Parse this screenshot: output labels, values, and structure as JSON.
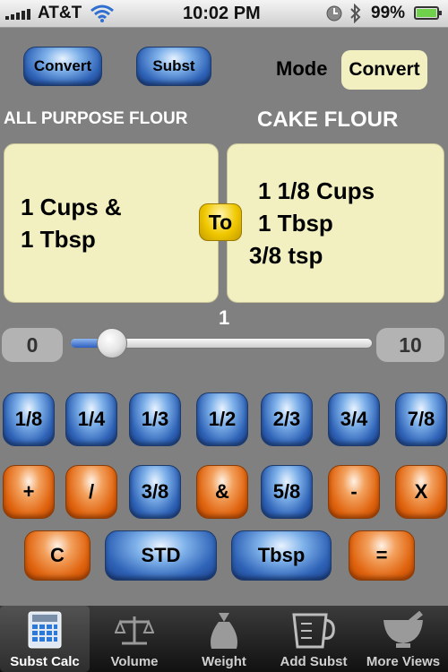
{
  "status": {
    "carrier": "AT&T",
    "time": "10:02 PM",
    "battery": "99%"
  },
  "top": {
    "convert_label": "Convert",
    "subst_label": "Subst",
    "mode_label": "Mode",
    "mode_value": "Convert"
  },
  "from": {
    "title": "ALL PURPOSE FLOUR",
    "line1": "1  Cups &",
    "line2": "1  Tbsp"
  },
  "to": {
    "title": "CAKE FLOUR",
    "line1": "1 1/8 Cups",
    "line2": "1  Tbsp",
    "line3": "3/8 tsp"
  },
  "to_button": "To",
  "slider": {
    "value": "1",
    "min": "0",
    "max": "10",
    "level": 0.1
  },
  "keys_row1": [
    "1/8",
    "1/4",
    "1/3",
    "1/2",
    "2/3",
    "3/4",
    "7/8"
  ],
  "keys_row2": [
    "+",
    "/",
    "3/8",
    "&",
    "5/8",
    "-",
    "X"
  ],
  "keys_row3": [
    "C",
    "STD",
    "Tbsp",
    "="
  ],
  "tabs": [
    "Subst Calc",
    "Volume",
    "Weight",
    "Add Subst",
    "More Views"
  ],
  "icons": {
    "wifi": "wifi-icon",
    "clock": "clock-icon",
    "bluetooth": "bluetooth-icon",
    "battery": "battery-icon"
  },
  "colors": {
    "background": "#808080",
    "panel": "#f2efc0",
    "mode_box": "#f2efc0",
    "to_button": "#f0c800"
  }
}
